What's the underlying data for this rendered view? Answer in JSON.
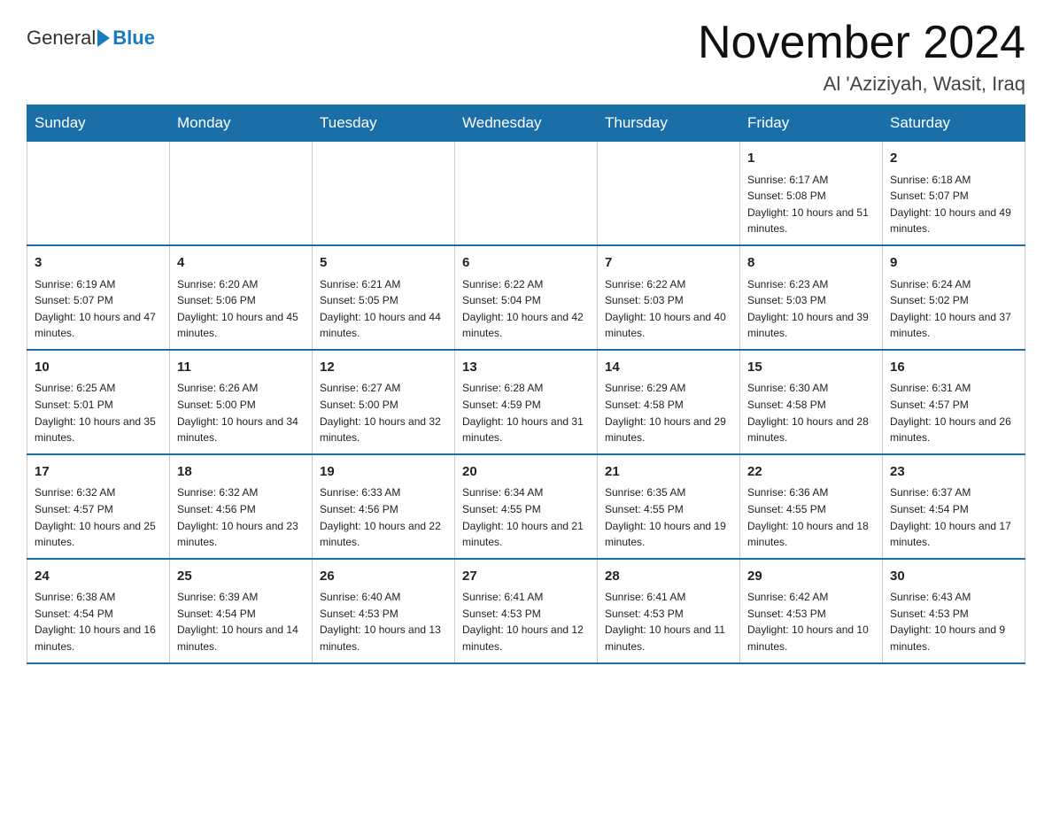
{
  "logo": {
    "general": "General",
    "blue": "Blue"
  },
  "title": "November 2024",
  "subtitle": "Al 'Aziziyah, Wasit, Iraq",
  "weekdays": [
    "Sunday",
    "Monday",
    "Tuesday",
    "Wednesday",
    "Thursday",
    "Friday",
    "Saturday"
  ],
  "weeks": [
    [
      {
        "day": "",
        "info": ""
      },
      {
        "day": "",
        "info": ""
      },
      {
        "day": "",
        "info": ""
      },
      {
        "day": "",
        "info": ""
      },
      {
        "day": "",
        "info": ""
      },
      {
        "day": "1",
        "info": "Sunrise: 6:17 AM\nSunset: 5:08 PM\nDaylight: 10 hours and 51 minutes."
      },
      {
        "day": "2",
        "info": "Sunrise: 6:18 AM\nSunset: 5:07 PM\nDaylight: 10 hours and 49 minutes."
      }
    ],
    [
      {
        "day": "3",
        "info": "Sunrise: 6:19 AM\nSunset: 5:07 PM\nDaylight: 10 hours and 47 minutes."
      },
      {
        "day": "4",
        "info": "Sunrise: 6:20 AM\nSunset: 5:06 PM\nDaylight: 10 hours and 45 minutes."
      },
      {
        "day": "5",
        "info": "Sunrise: 6:21 AM\nSunset: 5:05 PM\nDaylight: 10 hours and 44 minutes."
      },
      {
        "day": "6",
        "info": "Sunrise: 6:22 AM\nSunset: 5:04 PM\nDaylight: 10 hours and 42 minutes."
      },
      {
        "day": "7",
        "info": "Sunrise: 6:22 AM\nSunset: 5:03 PM\nDaylight: 10 hours and 40 minutes."
      },
      {
        "day": "8",
        "info": "Sunrise: 6:23 AM\nSunset: 5:03 PM\nDaylight: 10 hours and 39 minutes."
      },
      {
        "day": "9",
        "info": "Sunrise: 6:24 AM\nSunset: 5:02 PM\nDaylight: 10 hours and 37 minutes."
      }
    ],
    [
      {
        "day": "10",
        "info": "Sunrise: 6:25 AM\nSunset: 5:01 PM\nDaylight: 10 hours and 35 minutes."
      },
      {
        "day": "11",
        "info": "Sunrise: 6:26 AM\nSunset: 5:00 PM\nDaylight: 10 hours and 34 minutes."
      },
      {
        "day": "12",
        "info": "Sunrise: 6:27 AM\nSunset: 5:00 PM\nDaylight: 10 hours and 32 minutes."
      },
      {
        "day": "13",
        "info": "Sunrise: 6:28 AM\nSunset: 4:59 PM\nDaylight: 10 hours and 31 minutes."
      },
      {
        "day": "14",
        "info": "Sunrise: 6:29 AM\nSunset: 4:58 PM\nDaylight: 10 hours and 29 minutes."
      },
      {
        "day": "15",
        "info": "Sunrise: 6:30 AM\nSunset: 4:58 PM\nDaylight: 10 hours and 28 minutes."
      },
      {
        "day": "16",
        "info": "Sunrise: 6:31 AM\nSunset: 4:57 PM\nDaylight: 10 hours and 26 minutes."
      }
    ],
    [
      {
        "day": "17",
        "info": "Sunrise: 6:32 AM\nSunset: 4:57 PM\nDaylight: 10 hours and 25 minutes."
      },
      {
        "day": "18",
        "info": "Sunrise: 6:32 AM\nSunset: 4:56 PM\nDaylight: 10 hours and 23 minutes."
      },
      {
        "day": "19",
        "info": "Sunrise: 6:33 AM\nSunset: 4:56 PM\nDaylight: 10 hours and 22 minutes."
      },
      {
        "day": "20",
        "info": "Sunrise: 6:34 AM\nSunset: 4:55 PM\nDaylight: 10 hours and 21 minutes."
      },
      {
        "day": "21",
        "info": "Sunrise: 6:35 AM\nSunset: 4:55 PM\nDaylight: 10 hours and 19 minutes."
      },
      {
        "day": "22",
        "info": "Sunrise: 6:36 AM\nSunset: 4:55 PM\nDaylight: 10 hours and 18 minutes."
      },
      {
        "day": "23",
        "info": "Sunrise: 6:37 AM\nSunset: 4:54 PM\nDaylight: 10 hours and 17 minutes."
      }
    ],
    [
      {
        "day": "24",
        "info": "Sunrise: 6:38 AM\nSunset: 4:54 PM\nDaylight: 10 hours and 16 minutes."
      },
      {
        "day": "25",
        "info": "Sunrise: 6:39 AM\nSunset: 4:54 PM\nDaylight: 10 hours and 14 minutes."
      },
      {
        "day": "26",
        "info": "Sunrise: 6:40 AM\nSunset: 4:53 PM\nDaylight: 10 hours and 13 minutes."
      },
      {
        "day": "27",
        "info": "Sunrise: 6:41 AM\nSunset: 4:53 PM\nDaylight: 10 hours and 12 minutes."
      },
      {
        "day": "28",
        "info": "Sunrise: 6:41 AM\nSunset: 4:53 PM\nDaylight: 10 hours and 11 minutes."
      },
      {
        "day": "29",
        "info": "Sunrise: 6:42 AM\nSunset: 4:53 PM\nDaylight: 10 hours and 10 minutes."
      },
      {
        "day": "30",
        "info": "Sunrise: 6:43 AM\nSunset: 4:53 PM\nDaylight: 10 hours and 9 minutes."
      }
    ]
  ]
}
